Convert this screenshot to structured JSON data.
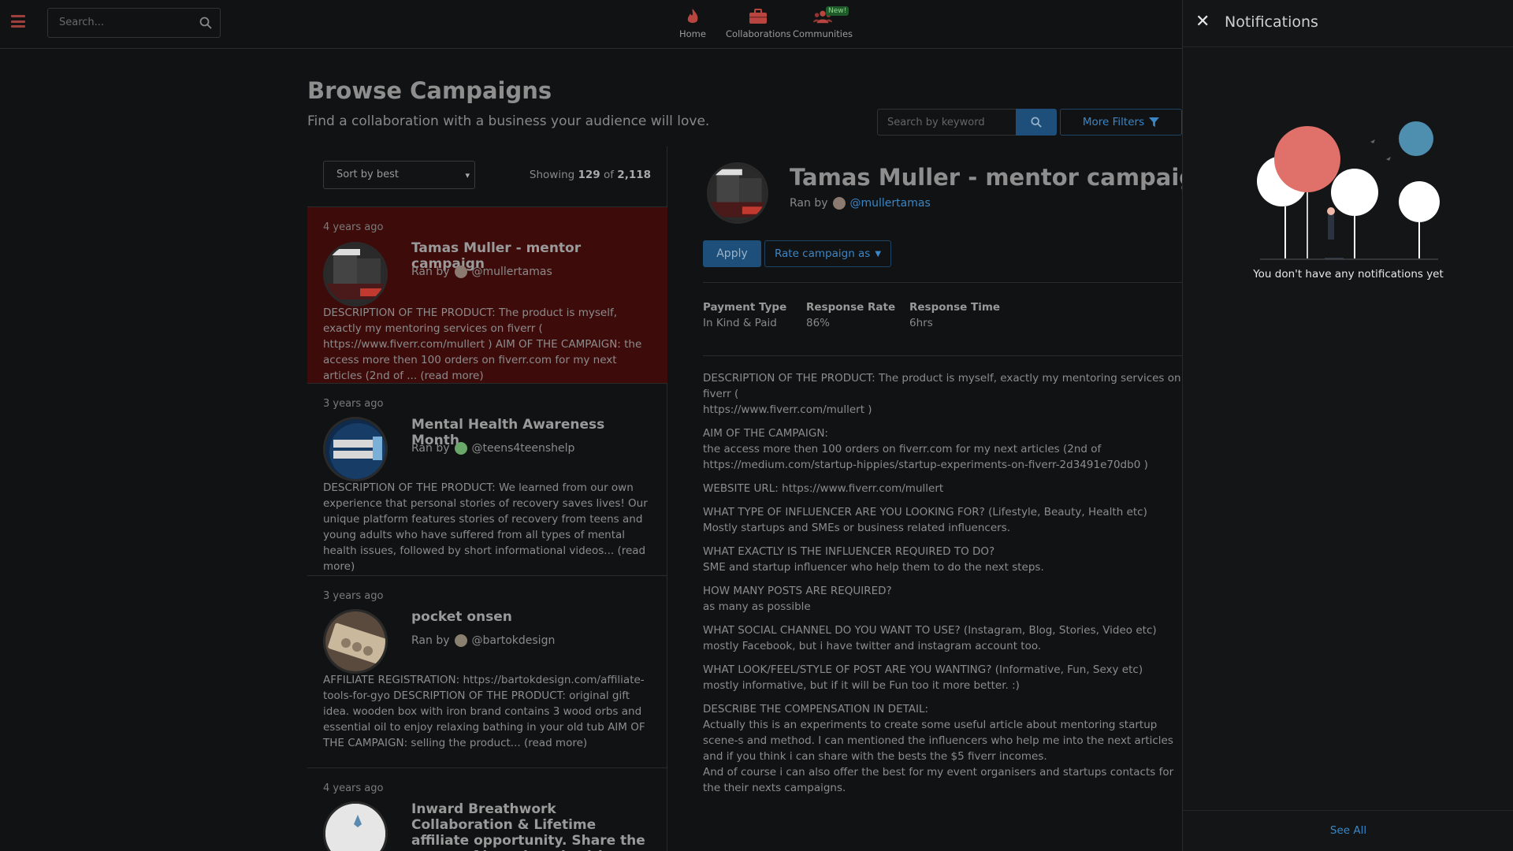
{
  "topbar": {
    "search_placeholder": "Search...",
    "nav": [
      {
        "label": "Home",
        "icon": "flame-icon"
      },
      {
        "label": "Collaborations",
        "icon": "briefcase-icon"
      },
      {
        "label": "Communities",
        "icon": "users-icon",
        "badge": "New!"
      }
    ]
  },
  "page": {
    "title": "Browse Campaigns",
    "subtitle": "Find a collaboration with a business your audience will love.",
    "keyword_placeholder": "Search by keyword",
    "more_filters": "More Filters"
  },
  "list": {
    "sort_label": "Sort by best",
    "showing_prefix": "Showing",
    "showing_count": "129",
    "showing_of": "of",
    "showing_total": "2,118",
    "items": [
      {
        "ago": "4 years ago",
        "title": "Tamas Muller - mentor campaign",
        "ran_by": "Ran by",
        "handle": "@mullertamas",
        "desc": "DESCRIPTION OF THE PRODUCT: The product is myself, exactly my mentoring services on fiverr ( https://www.fiverr.com/mullert ) AIM OF THE CAMPAIGN: the access more then 100 orders on fiverr.com for my next articles (2nd of ... (read more)"
      },
      {
        "ago": "3 years ago",
        "title": "Mental Health Awareness Month",
        "ran_by": "Ran by",
        "handle": "@teens4teenshelp",
        "desc": "DESCRIPTION OF THE PRODUCT: We learned from our own experience that personal stories of recovery saves lives! Our unique platform features stories of recovery from teens and young adults who have suffered from all types of mental health issues, followed by short informational videos... (read more)"
      },
      {
        "ago": "3 years ago",
        "title": "pocket onsen",
        "ran_by": "Ran by",
        "handle": "@bartokdesign",
        "desc": "AFFILIATE REGISTRATION: https://bartokdesign.com/affiliate-tools-for-gyo DESCRIPTION OF THE PRODUCT: original gift idea. wooden box with iron brand contains 3 wood orbs and essential oil to enjoy relaxing bathing in your old tub AIM OF THE CAMPAIGN: selling the product... (read more)"
      },
      {
        "ago": "4 years ago",
        "title": "Inward Breathwork Collaboration & Lifetime affiliate opportunity. Share the power of breathwork with your"
      }
    ]
  },
  "detail": {
    "title": "Tamas Muller - mentor campaign",
    "ran_by": "Ran by",
    "handle": "@mullertamas",
    "apply": "Apply",
    "rate": "Rate campaign as",
    "stats": [
      {
        "key": "Payment Type",
        "value": "In Kind & Paid"
      },
      {
        "key": "Response Rate",
        "value": "86%"
      },
      {
        "key": "Response Time",
        "value": "6hrs"
      }
    ],
    "body": [
      "DESCRIPTION OF THE PRODUCT: The product is myself, exactly my mentoring services on fiverr (\nhttps://www.fiverr.com/mullert )",
      "AIM OF THE CAMPAIGN:\nthe access more then 100 orders on fiverr.com for my next articles (2nd of\nhttps://medium.com/startup-hippies/startup-experiments-on-fiverr-2d3491e70db0 )",
      "WEBSITE URL: https://www.fiverr.com/mullert",
      "WHAT TYPE OF INFLUENCER ARE YOU LOOKING FOR? (Lifestyle, Beauty, Health etc)\nMostly startups and SMEs or business related influencers.",
      "WHAT EXACTLY IS THE INFLUENCER REQUIRED TO DO?\nSME and startup influencer who help them to do the next steps.",
      "HOW MANY POSTS ARE REQUIRED?\nas many as possible",
      "WHAT SOCIAL CHANNEL DO YOU WANT TO USE? (Instagram, Blog, Stories, Video etc)\nmostly Facebook, but i have twitter and instagram account too.",
      "WHAT LOOK/FEEL/STYLE OF POST ARE YOU WANTING? (Informative, Fun, Sexy etc)\nmostly informative, but if it will be Fun too it more better. :)",
      "DESCRIBE THE COMPENSATION IN DETAIL:\nActually this is an experiments to create some useful article about mentoring startup scene-s and method. I can mentioned the influencers who help me into the next articles and if you think i can share with the bests the $5 fiverr incomes.\nAnd of course i can also offer the best for my event organisers and startups contacts for the their nexts campaigns."
    ]
  },
  "notifications": {
    "title": "Notifications",
    "close_icon": "close-icon",
    "empty": "You don't have any notifications yet",
    "see_all": "See All"
  },
  "colors": {
    "accent_blue": "#3b86c6",
    "button_blue": "#1d4f7a",
    "active_item": "#3e0b0b",
    "brand_red": "#d9534f"
  }
}
